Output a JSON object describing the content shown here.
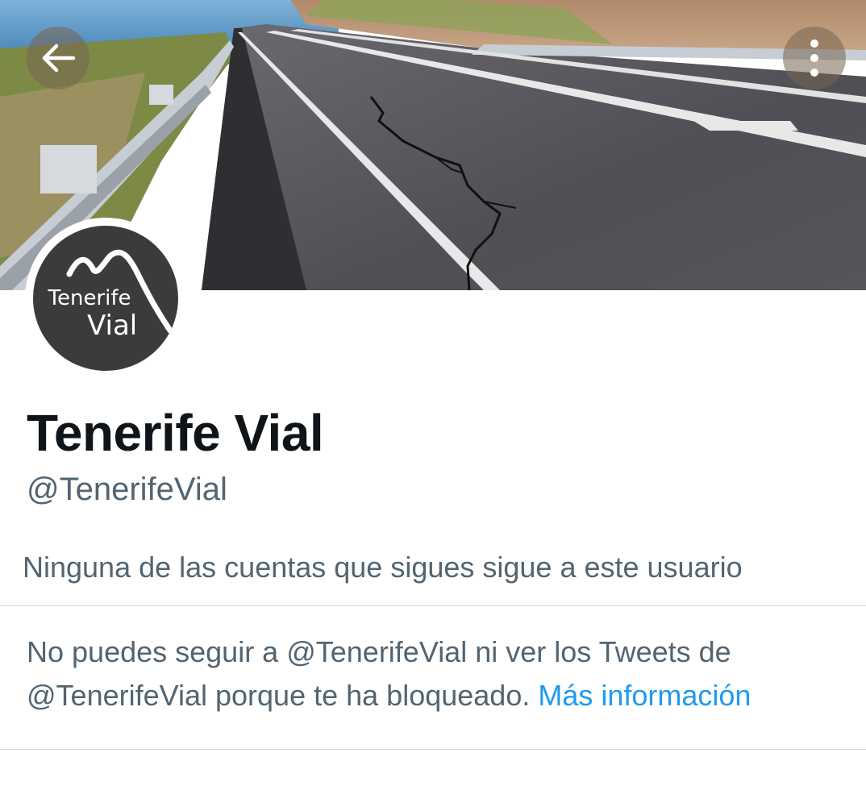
{
  "header": {
    "back_icon": "arrow-left-icon",
    "more_icon": "more-vertical-icon",
    "banner_image": "road-with-cracked-asphalt-photo"
  },
  "profile": {
    "avatar_logo_text_line1": "Tenerife",
    "avatar_logo_text_line2": "Vial",
    "display_name": "Tenerife Vial",
    "handle": "@TenerifeVial",
    "followers_you_know": "Ninguna de las cuentas que sigues sigue a este usuario"
  },
  "blocked": {
    "message": "No puedes seguir a @TenerifeVial ni ver los Tweets de @TenerifeVial porque te ha bloqueado.",
    "link_label": "Más información"
  },
  "colors": {
    "text_primary": "#0f1419",
    "text_secondary": "#536471",
    "link": "#1d9bf0",
    "divider": "#cfd9de",
    "avatar_bg": "#3b3b3b"
  }
}
